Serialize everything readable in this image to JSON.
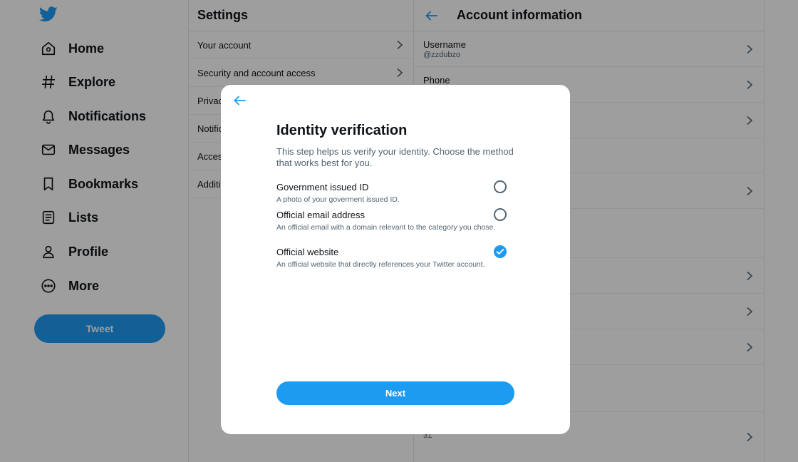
{
  "nav": {
    "logo_icon": "twitter-bird-icon",
    "items": [
      {
        "label": "Home",
        "icon": "home-icon"
      },
      {
        "label": "Explore",
        "icon": "hashtag-icon"
      },
      {
        "label": "Notifications",
        "icon": "bell-icon"
      },
      {
        "label": "Messages",
        "icon": "envelope-icon"
      },
      {
        "label": "Bookmarks",
        "icon": "bookmark-icon"
      },
      {
        "label": "Lists",
        "icon": "list-icon"
      },
      {
        "label": "Profile",
        "icon": "person-icon"
      },
      {
        "label": "More",
        "icon": "more-circle-icon"
      }
    ],
    "tweet_label": "Tweet"
  },
  "settings": {
    "title": "Settings",
    "items": [
      {
        "label": "Your account"
      },
      {
        "label": "Security and account access"
      },
      {
        "label": "Privacy and safety"
      },
      {
        "label": "Notifications"
      },
      {
        "label": "Accessibility, display, and languages"
      },
      {
        "label": "Additional resources"
      }
    ]
  },
  "account": {
    "title": "Account information",
    "username_label": "Username",
    "username_value": "@zzdubzo",
    "phone_label": "Phone",
    "bottom_value": "31"
  },
  "modal": {
    "title": "Identity verification",
    "description": "This step helps us verify your identity. Choose the method that works best for you.",
    "options": [
      {
        "title": "Government issued ID",
        "desc": "A photo of your goverment issued ID.",
        "selected": false
      },
      {
        "title": "Official email address",
        "desc": "An official email with a domain relevant to the category you chose.",
        "selected": false
      },
      {
        "title": "Official website",
        "desc": "An official website that directly references your Twitter account.",
        "selected": true
      }
    ],
    "next_label": "Next"
  },
  "colors": {
    "accent": "#1d9bf0",
    "text_primary": "#0f1419",
    "text_secondary": "#536471"
  }
}
